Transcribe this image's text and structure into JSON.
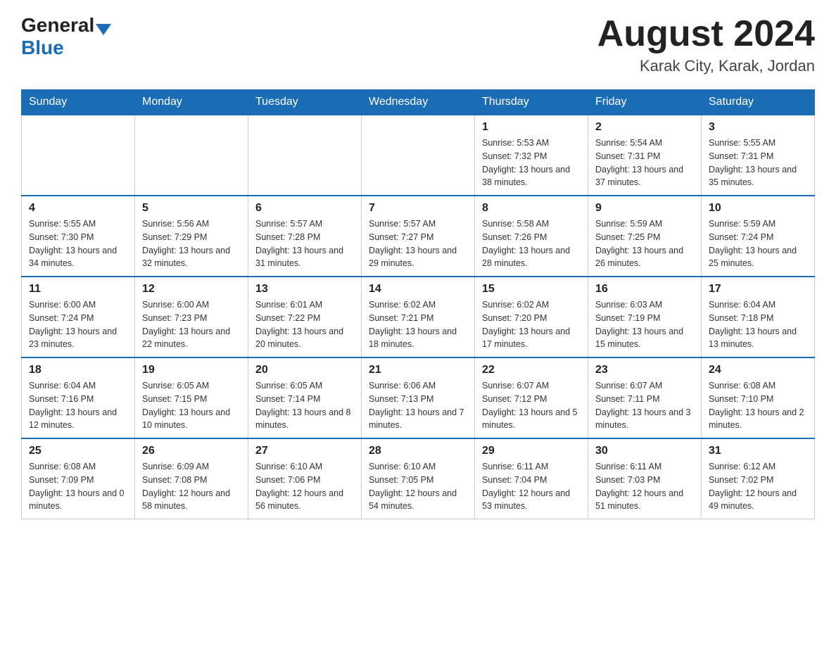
{
  "header": {
    "logo_general": "General",
    "logo_blue": "Blue",
    "month_title": "August 2024",
    "location": "Karak City, Karak, Jordan"
  },
  "weekdays": [
    "Sunday",
    "Monday",
    "Tuesday",
    "Wednesday",
    "Thursday",
    "Friday",
    "Saturday"
  ],
  "weeks": [
    [
      {
        "day": "",
        "sunrise": "",
        "sunset": "",
        "daylight": ""
      },
      {
        "day": "",
        "sunrise": "",
        "sunset": "",
        "daylight": ""
      },
      {
        "day": "",
        "sunrise": "",
        "sunset": "",
        "daylight": ""
      },
      {
        "day": "",
        "sunrise": "",
        "sunset": "",
        "daylight": ""
      },
      {
        "day": "1",
        "sunrise": "Sunrise: 5:53 AM",
        "sunset": "Sunset: 7:32 PM",
        "daylight": "Daylight: 13 hours and 38 minutes."
      },
      {
        "day": "2",
        "sunrise": "Sunrise: 5:54 AM",
        "sunset": "Sunset: 7:31 PM",
        "daylight": "Daylight: 13 hours and 37 minutes."
      },
      {
        "day": "3",
        "sunrise": "Sunrise: 5:55 AM",
        "sunset": "Sunset: 7:31 PM",
        "daylight": "Daylight: 13 hours and 35 minutes."
      }
    ],
    [
      {
        "day": "4",
        "sunrise": "Sunrise: 5:55 AM",
        "sunset": "Sunset: 7:30 PM",
        "daylight": "Daylight: 13 hours and 34 minutes."
      },
      {
        "day": "5",
        "sunrise": "Sunrise: 5:56 AM",
        "sunset": "Sunset: 7:29 PM",
        "daylight": "Daylight: 13 hours and 32 minutes."
      },
      {
        "day": "6",
        "sunrise": "Sunrise: 5:57 AM",
        "sunset": "Sunset: 7:28 PM",
        "daylight": "Daylight: 13 hours and 31 minutes."
      },
      {
        "day": "7",
        "sunrise": "Sunrise: 5:57 AM",
        "sunset": "Sunset: 7:27 PM",
        "daylight": "Daylight: 13 hours and 29 minutes."
      },
      {
        "day": "8",
        "sunrise": "Sunrise: 5:58 AM",
        "sunset": "Sunset: 7:26 PM",
        "daylight": "Daylight: 13 hours and 28 minutes."
      },
      {
        "day": "9",
        "sunrise": "Sunrise: 5:59 AM",
        "sunset": "Sunset: 7:25 PM",
        "daylight": "Daylight: 13 hours and 26 minutes."
      },
      {
        "day": "10",
        "sunrise": "Sunrise: 5:59 AM",
        "sunset": "Sunset: 7:24 PM",
        "daylight": "Daylight: 13 hours and 25 minutes."
      }
    ],
    [
      {
        "day": "11",
        "sunrise": "Sunrise: 6:00 AM",
        "sunset": "Sunset: 7:24 PM",
        "daylight": "Daylight: 13 hours and 23 minutes."
      },
      {
        "day": "12",
        "sunrise": "Sunrise: 6:00 AM",
        "sunset": "Sunset: 7:23 PM",
        "daylight": "Daylight: 13 hours and 22 minutes."
      },
      {
        "day": "13",
        "sunrise": "Sunrise: 6:01 AM",
        "sunset": "Sunset: 7:22 PM",
        "daylight": "Daylight: 13 hours and 20 minutes."
      },
      {
        "day": "14",
        "sunrise": "Sunrise: 6:02 AM",
        "sunset": "Sunset: 7:21 PM",
        "daylight": "Daylight: 13 hours and 18 minutes."
      },
      {
        "day": "15",
        "sunrise": "Sunrise: 6:02 AM",
        "sunset": "Sunset: 7:20 PM",
        "daylight": "Daylight: 13 hours and 17 minutes."
      },
      {
        "day": "16",
        "sunrise": "Sunrise: 6:03 AM",
        "sunset": "Sunset: 7:19 PM",
        "daylight": "Daylight: 13 hours and 15 minutes."
      },
      {
        "day": "17",
        "sunrise": "Sunrise: 6:04 AM",
        "sunset": "Sunset: 7:18 PM",
        "daylight": "Daylight: 13 hours and 13 minutes."
      }
    ],
    [
      {
        "day": "18",
        "sunrise": "Sunrise: 6:04 AM",
        "sunset": "Sunset: 7:16 PM",
        "daylight": "Daylight: 13 hours and 12 minutes."
      },
      {
        "day": "19",
        "sunrise": "Sunrise: 6:05 AM",
        "sunset": "Sunset: 7:15 PM",
        "daylight": "Daylight: 13 hours and 10 minutes."
      },
      {
        "day": "20",
        "sunrise": "Sunrise: 6:05 AM",
        "sunset": "Sunset: 7:14 PM",
        "daylight": "Daylight: 13 hours and 8 minutes."
      },
      {
        "day": "21",
        "sunrise": "Sunrise: 6:06 AM",
        "sunset": "Sunset: 7:13 PM",
        "daylight": "Daylight: 13 hours and 7 minutes."
      },
      {
        "day": "22",
        "sunrise": "Sunrise: 6:07 AM",
        "sunset": "Sunset: 7:12 PM",
        "daylight": "Daylight: 13 hours and 5 minutes."
      },
      {
        "day": "23",
        "sunrise": "Sunrise: 6:07 AM",
        "sunset": "Sunset: 7:11 PM",
        "daylight": "Daylight: 13 hours and 3 minutes."
      },
      {
        "day": "24",
        "sunrise": "Sunrise: 6:08 AM",
        "sunset": "Sunset: 7:10 PM",
        "daylight": "Daylight: 13 hours and 2 minutes."
      }
    ],
    [
      {
        "day": "25",
        "sunrise": "Sunrise: 6:08 AM",
        "sunset": "Sunset: 7:09 PM",
        "daylight": "Daylight: 13 hours and 0 minutes."
      },
      {
        "day": "26",
        "sunrise": "Sunrise: 6:09 AM",
        "sunset": "Sunset: 7:08 PM",
        "daylight": "Daylight: 12 hours and 58 minutes."
      },
      {
        "day": "27",
        "sunrise": "Sunrise: 6:10 AM",
        "sunset": "Sunset: 7:06 PM",
        "daylight": "Daylight: 12 hours and 56 minutes."
      },
      {
        "day": "28",
        "sunrise": "Sunrise: 6:10 AM",
        "sunset": "Sunset: 7:05 PM",
        "daylight": "Daylight: 12 hours and 54 minutes."
      },
      {
        "day": "29",
        "sunrise": "Sunrise: 6:11 AM",
        "sunset": "Sunset: 7:04 PM",
        "daylight": "Daylight: 12 hours and 53 minutes."
      },
      {
        "day": "30",
        "sunrise": "Sunrise: 6:11 AM",
        "sunset": "Sunset: 7:03 PM",
        "daylight": "Daylight: 12 hours and 51 minutes."
      },
      {
        "day": "31",
        "sunrise": "Sunrise: 6:12 AM",
        "sunset": "Sunset: 7:02 PM",
        "daylight": "Daylight: 12 hours and 49 minutes."
      }
    ]
  ]
}
